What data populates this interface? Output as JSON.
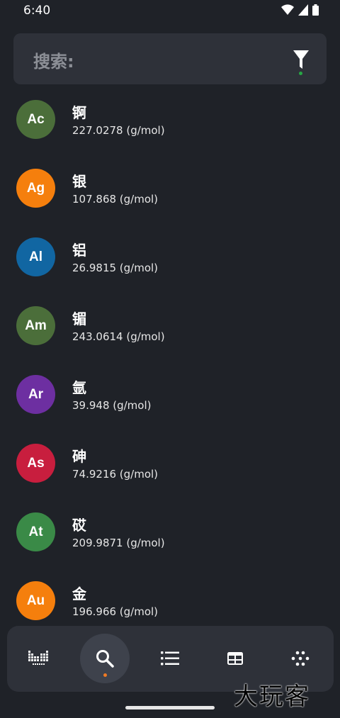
{
  "status_bar": {
    "time": "6:40"
  },
  "search": {
    "placeholder": "搜索:",
    "filter_active_color": "#27a745"
  },
  "elements": [
    {
      "symbol": "Ac",
      "name": "锕",
      "mass": "227.0278 (g/mol)",
      "color": "#4b6e3a"
    },
    {
      "symbol": "Ag",
      "name": "银",
      "mass": "107.868 (g/mol)",
      "color": "#f57f0d"
    },
    {
      "symbol": "Al",
      "name": "铝",
      "mass": "26.9815 (g/mol)",
      "color": "#1166a2"
    },
    {
      "symbol": "Am",
      "name": "镅",
      "mass": "243.0614 (g/mol)",
      "color": "#4b6e3a"
    },
    {
      "symbol": "Ar",
      "name": "氩",
      "mass": "39.948 (g/mol)",
      "color": "#6d2fa1"
    },
    {
      "symbol": "As",
      "name": "砷",
      "mass": "74.9216 (g/mol)",
      "color": "#c81e3e"
    },
    {
      "symbol": "At",
      "name": "砹",
      "mass": "209.9871 (g/mol)",
      "color": "#3a8a47"
    },
    {
      "symbol": "Au",
      "name": "金",
      "mass": "196.966 (g/mol)",
      "color": "#f57f0d"
    }
  ],
  "bottom_nav": {
    "items": [
      {
        "icon": "periodic-table-icon"
      },
      {
        "icon": "search-icon",
        "active": true
      },
      {
        "icon": "list-icon"
      },
      {
        "icon": "table-icon"
      },
      {
        "icon": "dots-grid-icon"
      }
    ],
    "active_color": "#f07a24"
  },
  "watermark": "大玩客"
}
